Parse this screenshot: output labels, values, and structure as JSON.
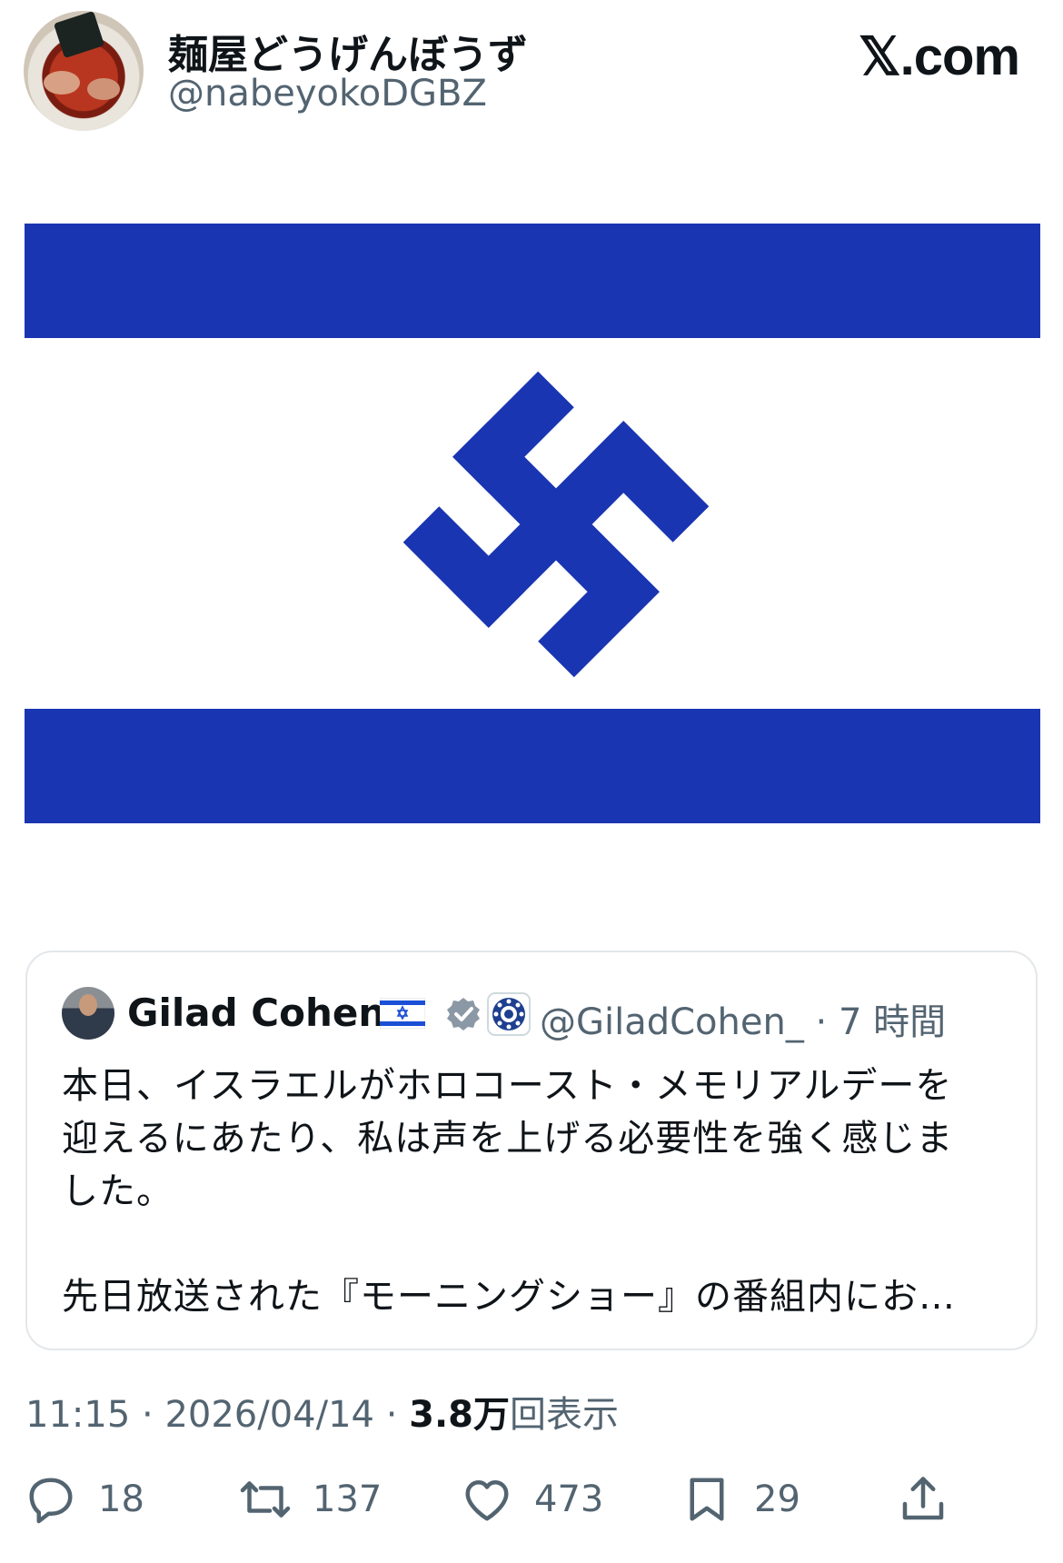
{
  "header": {
    "display_name": "麺屋どうげんぼうず",
    "handle": "@nabeyokoDGBZ",
    "site_logo": "𝕏.com",
    "avatar_icon": "ramen-avatar-icon"
  },
  "media": {
    "icon": "altered-flag-image",
    "colors": {
      "stripe": "#1a35b2",
      "background": "#ffffff"
    }
  },
  "quoted_post": {
    "name": "Gilad Cohen",
    "flag_icon": "israel-flag-icon",
    "verified_icon": "verified-badge-icon",
    "affiliation_icon": "government-affiliation-icon",
    "handle_time": "@GiladCohen_ · 7 時間",
    "text_lines": [
      "本日、イスラエルがホロコースト・メモリアルデーを",
      "迎えるにあたり、私は声を上げる必要性を強く感じま",
      "した。",
      "先日放送された『モーニングショー』の番組内にお…"
    ]
  },
  "meta": {
    "time": "11:15",
    "date": "2026/04/14",
    "sep": "·",
    "views_count": "3.8万",
    "views_label": "回表示"
  },
  "actions": {
    "reply_count": "18",
    "repost_count": "137",
    "like_count": "473",
    "bookmark_count": "29"
  }
}
